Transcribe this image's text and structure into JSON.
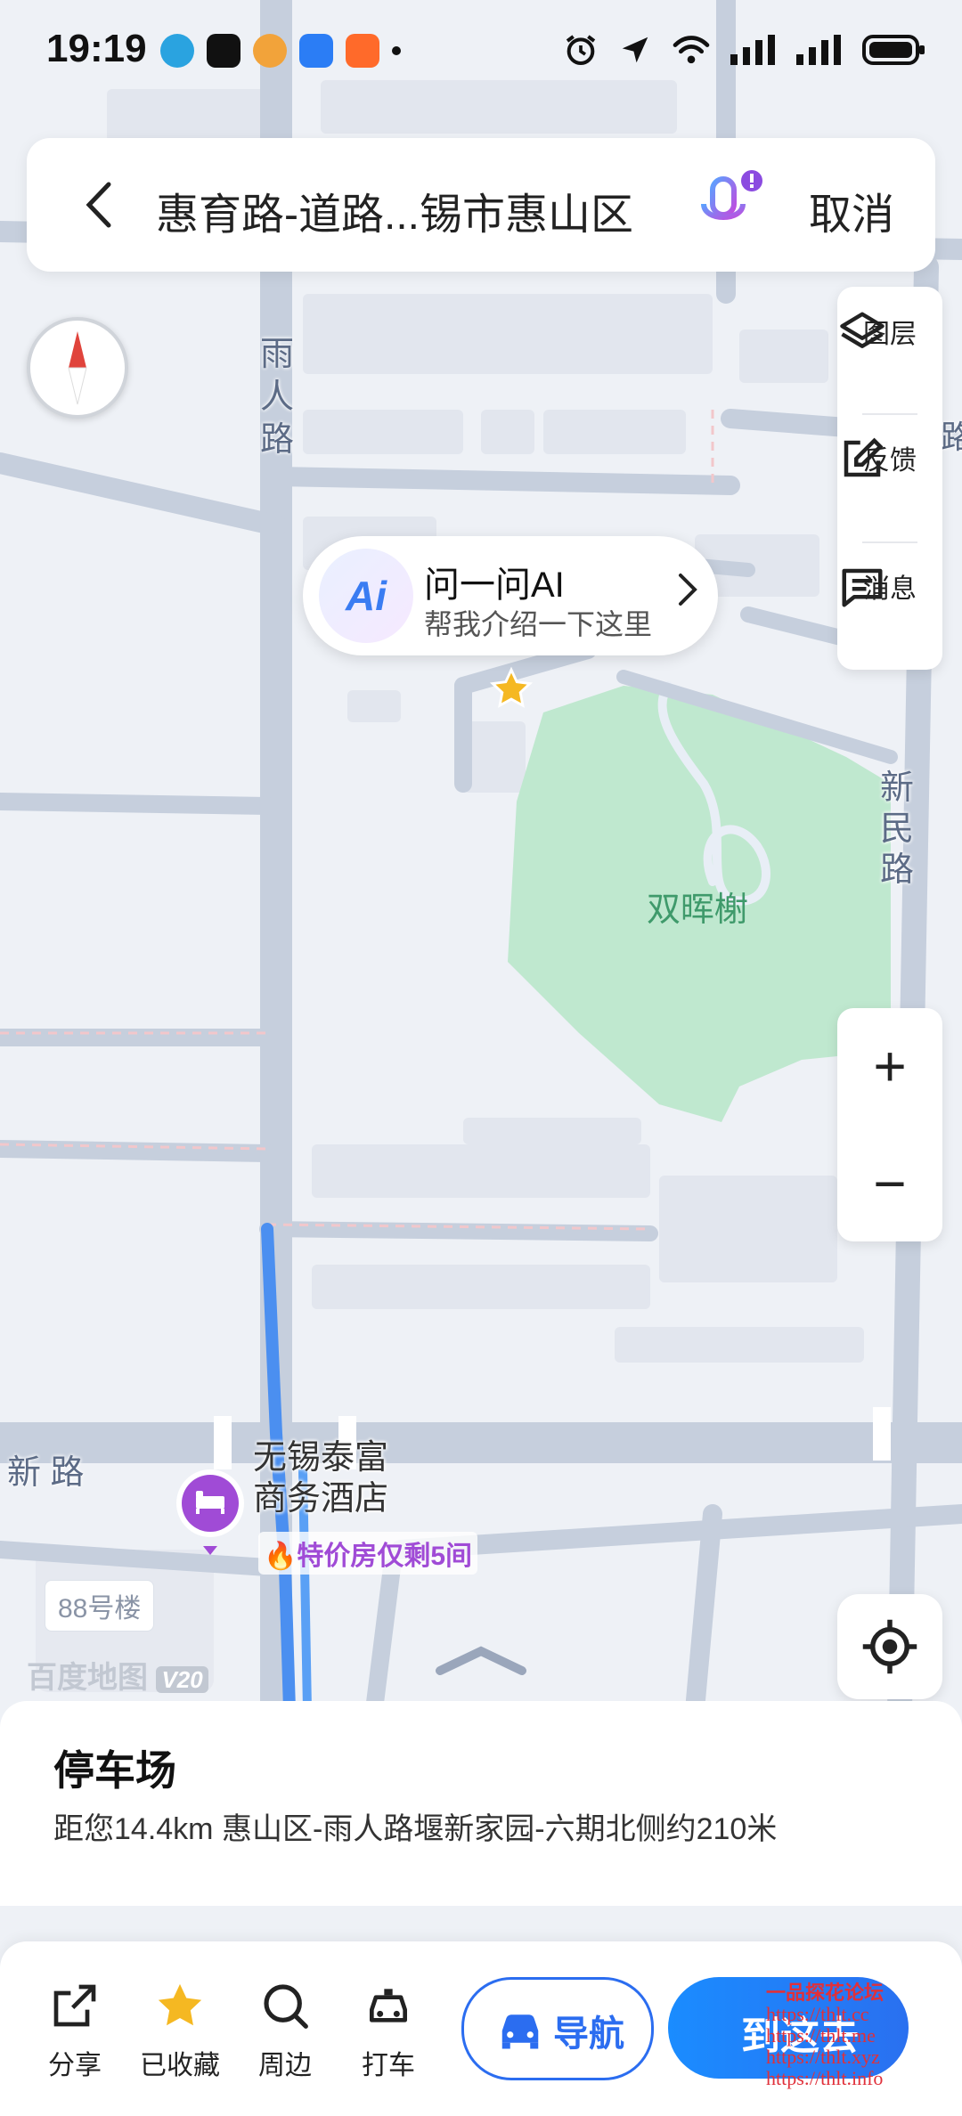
{
  "status_bar": {
    "time": "19:19"
  },
  "search": {
    "query": "惠育路-道路...锡市惠山区",
    "cancel_label": "取消"
  },
  "map_tools": {
    "layers_label": "图层",
    "feedback_label": "反馈",
    "message_label": "消息"
  },
  "zoom": {
    "in_label": "+",
    "out_label": "−"
  },
  "ai_bubble": {
    "logo": "Ai",
    "title": "问一问AI",
    "subtitle": "帮我介绍一下这里"
  },
  "map_labels": {
    "road_yuren": "雨人路",
    "road_xinmin": "新民路",
    "road_xin": "新 路",
    "road_right": "路",
    "park": "双晖榭",
    "hotel_name_line1": "无锡泰富",
    "hotel_name_line2": "商务酒店",
    "hotel_deal": "特价房仅剩5间",
    "building_tag": "88号楼",
    "watermark_brand": "百度地图",
    "watermark_version": "V20"
  },
  "place": {
    "title": "停车场",
    "distance_line": "距您14.4km  惠山区-雨人路堰新家园-六期北侧约210米"
  },
  "actions": {
    "share": "分享",
    "saved": "已收藏",
    "nearby": "周边",
    "taxi": "打车",
    "navigate": "导航",
    "go": "到这去"
  },
  "overlay_text": {
    "line1": "一品探花论坛",
    "line2": "https://thlt.cc",
    "line3": "https://thlt.me",
    "line4": "https://thlt.xyz",
    "line5": "https://thlt.info"
  },
  "colors": {
    "accent_blue": "#2b6df0",
    "park_green": "#bfe8cf",
    "star_yellow": "#f5b822",
    "hotel_purple": "#a04bd6"
  }
}
